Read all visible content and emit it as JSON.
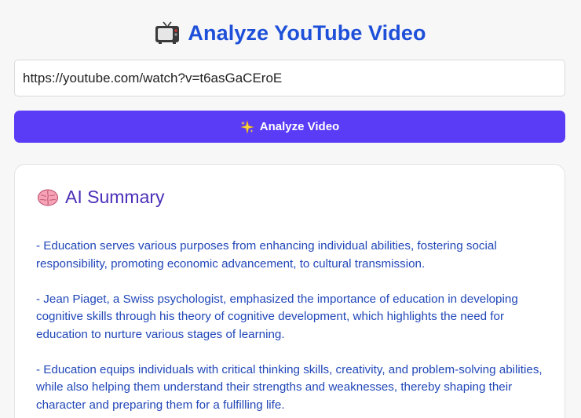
{
  "header": {
    "icon": "tv-icon",
    "title": "Analyze YouTube Video"
  },
  "url_input": {
    "value": "https://youtube.com/watch?v=t6asGaCEroE",
    "placeholder": ""
  },
  "analyze_button": {
    "icon": "sparkle-icon",
    "label": "Analyze Video"
  },
  "summary_card": {
    "icon": "brain-icon",
    "title": "AI Summary",
    "points": [
      " - Education serves various purposes from enhancing individual abilities, fostering social responsibility, promoting economic advancement, to cultural transmission.",
      "- Jean Piaget, a Swiss psychologist, emphasized the importance of education in developing cognitive skills through his theory of cognitive development, which highlights the need for education to nurture various stages of learning.",
      "- Education equips individuals with critical thinking skills, creativity, and problem-solving abilities, while also helping them understand their strengths and weaknesses, thereby shaping their character and preparing them for a fulfilling life."
    ]
  },
  "colors": {
    "title": "#1d4fd8",
    "button": "#5b3cf6",
    "card_title": "#4c2fb9",
    "summary_text": "#2147b8"
  }
}
